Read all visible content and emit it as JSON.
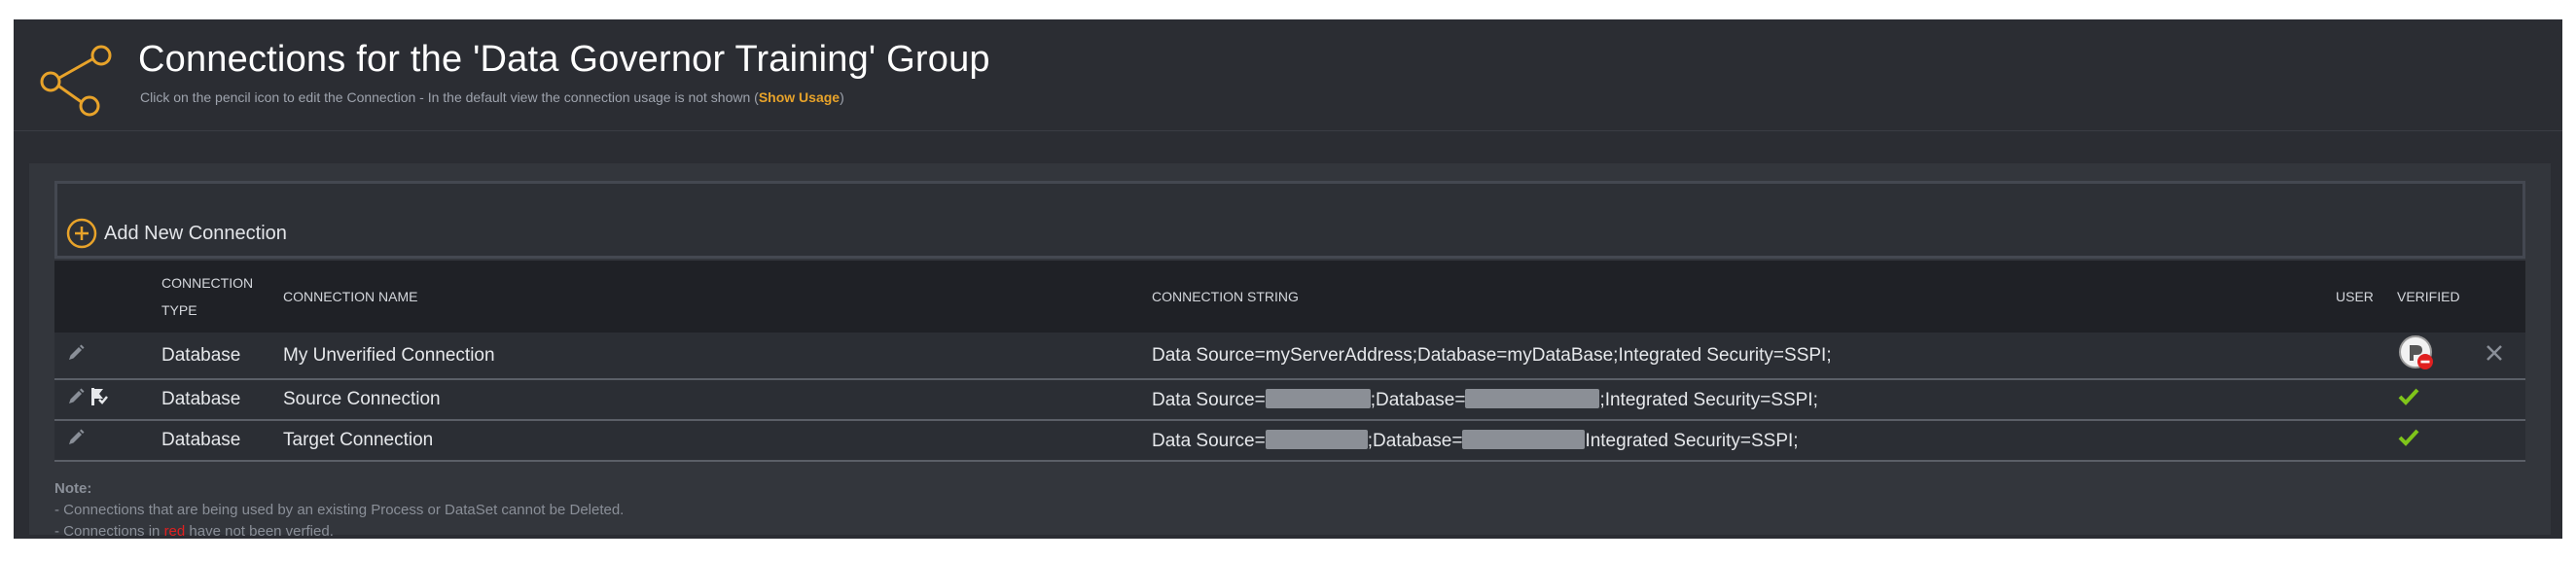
{
  "header": {
    "title": "Connections for the 'Data Governor Training' Group",
    "subtitle_pre": "Click on the pencil icon to edit the Connection - In the default view the connection usage is not shown (",
    "subtitle_link": "Show Usage",
    "subtitle_post": ")",
    "icon": "share-icon"
  },
  "actions": {
    "add_label": "Add New Connection",
    "add_icon": "plus-circle-icon"
  },
  "table": {
    "columns": {
      "type_line1": "CONNECTION",
      "type_line2": "TYPE",
      "name": "CONNECTION NAME",
      "string": "CONNECTION STRING",
      "user": "USER",
      "verified": "VERIFIED"
    },
    "rows": [
      {
        "type": "Database",
        "name": "My Unverified Connection",
        "conn_full": "Data Source=myServerAddress;Database=myDataBase;Integrated Security=SSPI;",
        "verified": false,
        "icons": [
          "pencil-icon",
          "unverified-badge-icon",
          "close-icon"
        ]
      },
      {
        "type": "Database",
        "name": "Source Connection",
        "conn_p1": "Data Source=",
        "conn_p2": ";Database=",
        "conn_p3": ";Integrated Security=SSPI;",
        "verified": true,
        "icons": [
          "pencil-icon",
          "flag-tool-icon",
          "check-icon"
        ]
      },
      {
        "type": "Database",
        "name": "Target Connection",
        "conn_p1": "Data Source=",
        "conn_p2": ";Database=",
        "conn_p3": "Integrated Security=SSPI;",
        "verified": true,
        "icons": [
          "pencil-icon",
          "check-icon"
        ]
      }
    ]
  },
  "notes": {
    "title": "Note:",
    "line1": "- Connections that are being used by an existing Process or DataSet cannot be Deleted.",
    "line2_pre": "- Connections in ",
    "line2_red": "red",
    "line2_post": " have not been verfied."
  },
  "colors": {
    "accent": "#e8a32a",
    "unverified": "#e02020",
    "verified": "#7fc41a"
  }
}
